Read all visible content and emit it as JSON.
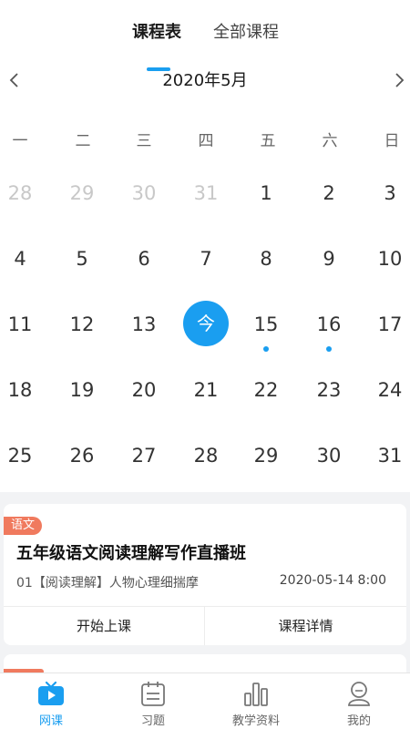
{
  "tabs": [
    {
      "label": "课程表",
      "active": true
    },
    {
      "label": "全部课程",
      "active": false
    }
  ],
  "calendar": {
    "month_title": "2020年5月",
    "weekdays": [
      "一",
      "二",
      "三",
      "四",
      "五",
      "六",
      "日"
    ],
    "weeks": [
      [
        {
          "d": "28",
          "other": true
        },
        {
          "d": "29",
          "other": true
        },
        {
          "d": "30",
          "other": true
        },
        {
          "d": "31",
          "other": true
        },
        {
          "d": "1"
        },
        {
          "d": "2"
        },
        {
          "d": "3"
        }
      ],
      [
        {
          "d": "4"
        },
        {
          "d": "5"
        },
        {
          "d": "6"
        },
        {
          "d": "7"
        },
        {
          "d": "8"
        },
        {
          "d": "9"
        },
        {
          "d": "10"
        }
      ],
      [
        {
          "d": "11"
        },
        {
          "d": "12"
        },
        {
          "d": "13"
        },
        {
          "d": "今",
          "today": true
        },
        {
          "d": "15",
          "dot": true
        },
        {
          "d": "16",
          "dot": true
        },
        {
          "d": "17"
        }
      ],
      [
        {
          "d": "18"
        },
        {
          "d": "19"
        },
        {
          "d": "20"
        },
        {
          "d": "21"
        },
        {
          "d": "22"
        },
        {
          "d": "23"
        },
        {
          "d": "24"
        }
      ],
      [
        {
          "d": "25"
        },
        {
          "d": "26"
        },
        {
          "d": "27"
        },
        {
          "d": "28"
        },
        {
          "d": "29"
        },
        {
          "d": "30"
        },
        {
          "d": "31"
        }
      ]
    ]
  },
  "course_card": {
    "tag": "语文",
    "title": "五年级语文阅读理解写作直播班",
    "lesson": "01【阅读理解】人物心理细揣摩",
    "time": "2020-05-14 8:00",
    "start_button": "开始上课",
    "detail_button": "课程详情"
  },
  "bottom_nav": [
    {
      "label": "网课",
      "icon": "tv-icon",
      "active": true
    },
    {
      "label": "习题",
      "icon": "calendar-exercise-icon",
      "active": false
    },
    {
      "label": "教学资料",
      "icon": "bar-chart-icon",
      "active": false
    },
    {
      "label": "我的",
      "icon": "profile-icon",
      "active": false
    }
  ],
  "colors": {
    "accent": "#1a9ef0",
    "tag": "#f07a5e",
    "muted_day": "#c8c8c8"
  }
}
